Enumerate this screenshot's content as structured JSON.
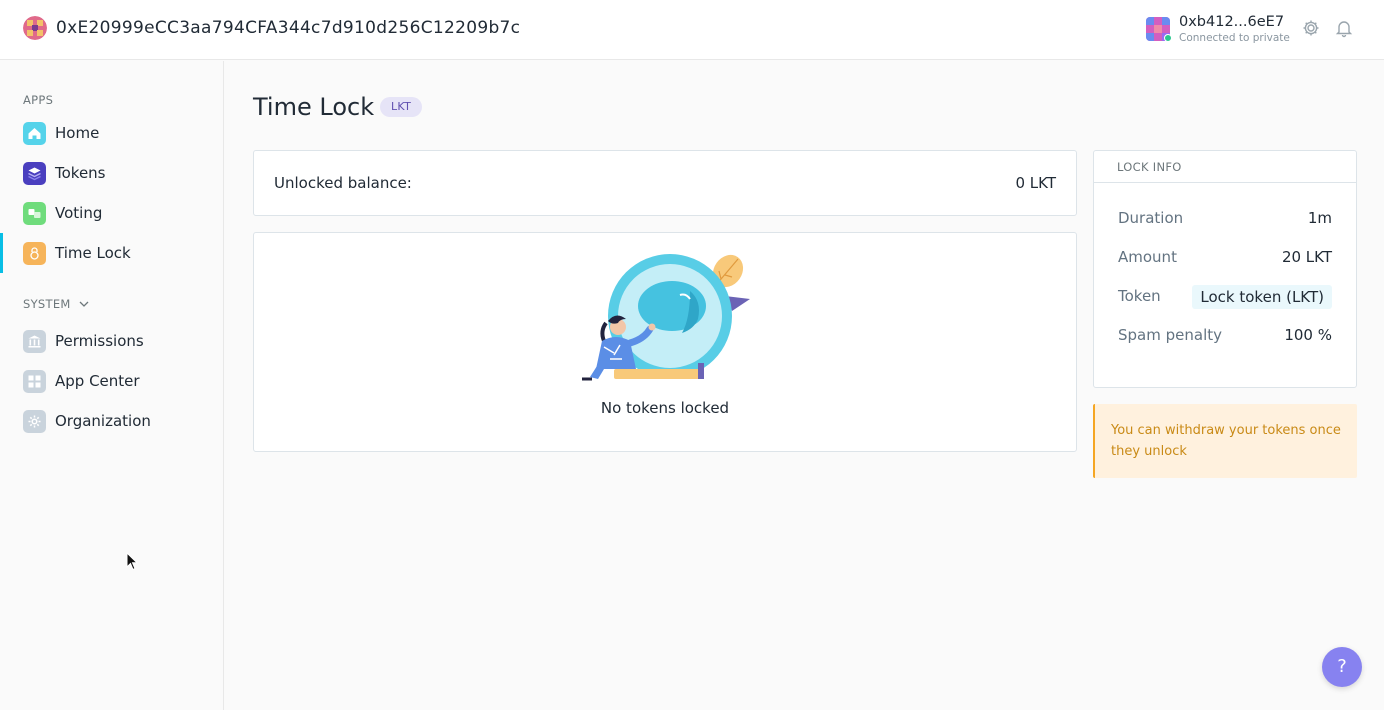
{
  "header": {
    "org_address": "0xE20999eCC3aa794CFA344c7d910d256C12209b7c",
    "account_address": "0xb412...6eE7",
    "network_status": "Connected to private",
    "icons": [
      "settings-gear-icon",
      "notification-bell-icon"
    ]
  },
  "sidebar": {
    "apps_heading": "APPS",
    "system_heading": "SYSTEM",
    "apps": [
      {
        "label": "Home",
        "icon": "home-icon",
        "color": "#4fd1e8"
      },
      {
        "label": "Tokens",
        "icon": "tokens-icon",
        "color": "#5b4fd6"
      },
      {
        "label": "Voting",
        "icon": "voting-icon",
        "color": "#7be27b"
      },
      {
        "label": "Time Lock",
        "icon": "time-lock-icon",
        "color": "#f8b45c"
      }
    ],
    "system": [
      {
        "label": "Permissions",
        "icon": "permissions-icon"
      },
      {
        "label": "App Center",
        "icon": "app-center-icon"
      },
      {
        "label": "Organization",
        "icon": "organization-icon"
      }
    ],
    "active": "Time Lock"
  },
  "main": {
    "title": "Time Lock",
    "badge": "LKT",
    "balance_label": "Unlocked balance:",
    "balance_value": "0 LKT",
    "empty_state": "No tokens locked"
  },
  "lock_info": {
    "heading": "LOCK INFO",
    "rows": [
      {
        "label": "Duration",
        "value": "1m"
      },
      {
        "label": "Amount",
        "value": "20 LKT"
      },
      {
        "label": "Token",
        "value": "Lock token (LKT)"
      },
      {
        "label": "Spam penalty",
        "value": "100 %"
      }
    ]
  },
  "warning": "You can withdraw your tokens once they unlock",
  "help_label": "?",
  "colors": {
    "accent": "#08bee5",
    "help": "#8782f0",
    "warning_text": "#c98a16"
  }
}
